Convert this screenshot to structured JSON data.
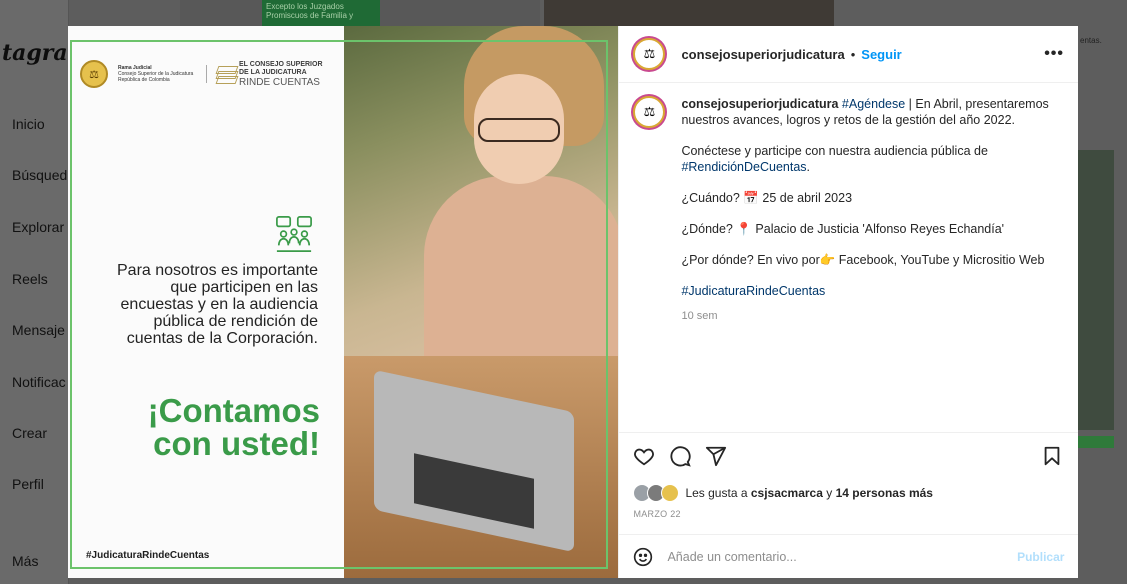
{
  "background": {
    "logo": "tagram",
    "nav": [
      "Inicio",
      "Búsqued",
      "Explorar",
      "Reels",
      "Mensaje",
      "Notificac",
      "Crear",
      "Perfil",
      "Más"
    ],
    "right_text": "entas.",
    "top_text": "Excepto los Juzgados Promiscuos de Familia y"
  },
  "post_image": {
    "rama_title": "Rama Judicial",
    "rama_sub": "Consejo Superior de la Judicatura",
    "rama_country": "República de Colombia",
    "consejo_line1": "EL CONSEJO SUPERIOR",
    "consejo_line2": "DE LA JUDICATURA",
    "consejo_line3": "RINDE CUENTAS",
    "tagline": "Para nosotros es importante que participen en las encuestas y en la audiencia pública de rendición de cuentas de la Corporación.",
    "headline_1": "¡Contamos",
    "headline_2": "con usted!",
    "hashtag": "#JudicaturaRindeCuentas"
  },
  "header": {
    "username": "consejosuperiorjudicatura",
    "separator": "•",
    "follow_label": "Seguir",
    "more_label": "•••"
  },
  "caption": {
    "username": "consejosuperiorjudicatura",
    "tag1": "#Agéndese",
    "line1_rest": " | En Abril, presentaremos nuestros avances, logros y retos de la gestión del año 2022.",
    "line2": "Conéctese y participe con nuestra audiencia pública de ",
    "tag2": "#RendiciónDeCuentas",
    "line2_end": ".",
    "when_label": "¿Cuándo? ",
    "when_icon": "📅",
    "when_value": " 25 de abril 2023",
    "where_label": "¿Dónde? ",
    "where_icon": "📍",
    "where_value": " Palacio de Justicia 'Alfonso Reyes Echandía'",
    "how_label": "¿Por dónde? En vivo por",
    "how_icon": "👉",
    "how_value": " Facebook, YouTube y Micrositio Web",
    "tag3": "#JudicaturaRindeCuentas",
    "time_ago": "10 sem"
  },
  "likes": {
    "prefix": "Les gusta a ",
    "user": "csjsacmarca",
    "middle": " y ",
    "others": "14 personas más"
  },
  "date": "MARZO 22",
  "comment": {
    "placeholder": "Añade un comentario...",
    "publish_label": "Publicar"
  },
  "colors": {
    "accent_blue": "#0095f6",
    "brand_green": "#3a9b49",
    "link": "#00376b"
  }
}
